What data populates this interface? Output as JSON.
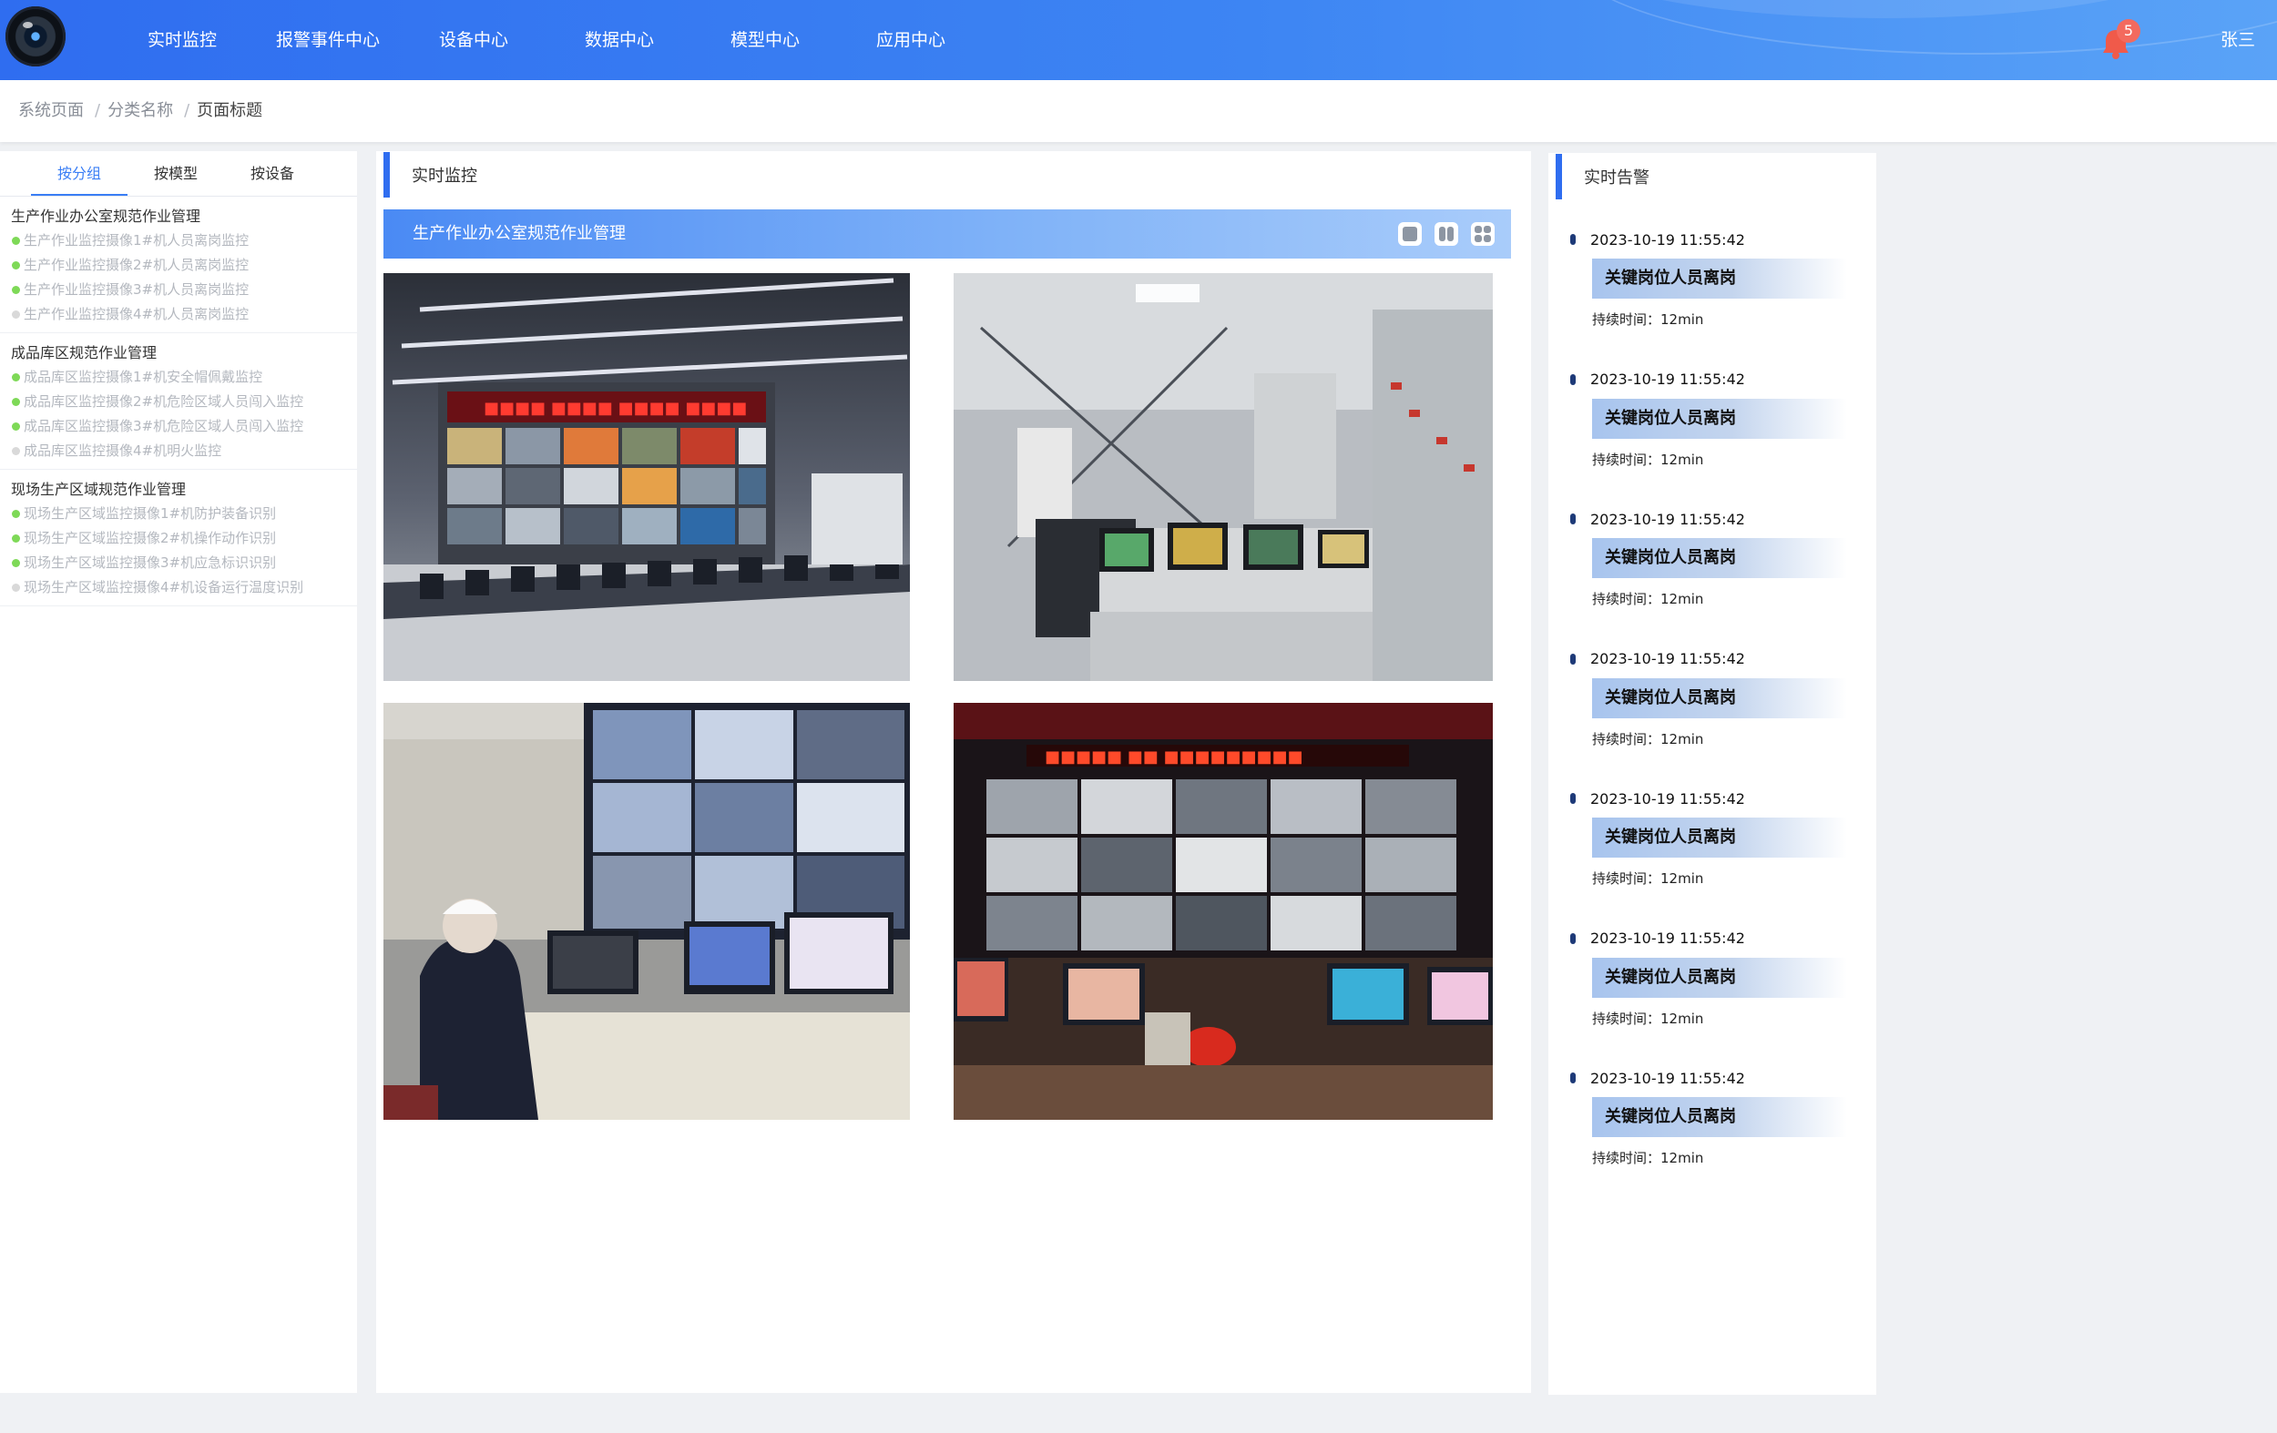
{
  "header": {
    "nav": [
      "实时监控",
      "报警事件中心",
      "设备中心",
      "数据中心",
      "模型中心",
      "应用中心"
    ],
    "notification_count": "5",
    "user_name": "张三",
    "colors": {
      "primary": "#2f6df0",
      "badge": "#f36a5e",
      "bell": "#f05a4a"
    }
  },
  "breadcrumb": {
    "items": [
      "系统页面",
      "分类名称"
    ],
    "current": "页面标题",
    "separator": "/"
  },
  "left_panel": {
    "tabs": [
      "按分组",
      "按模型",
      "按设备"
    ],
    "active_tab": "按分组",
    "groups": [
      {
        "title": "生产作业办公室规范作业管理",
        "cameras": [
          {
            "name": "生产作业监控摄像1#机人员离岗监控",
            "status": "online"
          },
          {
            "name": "生产作业监控摄像2#机人员离岗监控",
            "status": "online"
          },
          {
            "name": "生产作业监控摄像3#机人员离岗监控",
            "status": "online"
          },
          {
            "name": "生产作业监控摄像4#机人员离岗监控",
            "status": "offline"
          }
        ]
      },
      {
        "title": "成品库区规范作业管理",
        "cameras": [
          {
            "name": "成品库区监控摄像1#机安全帽佩戴监控",
            "status": "online"
          },
          {
            "name": "成品库区监控摄像2#机危险区域人员闯入监控",
            "status": "online"
          },
          {
            "name": "成品库区监控摄像3#机危险区域人员闯入监控",
            "status": "online"
          },
          {
            "name": "成品库区监控摄像4#机明火监控",
            "status": "offline"
          }
        ]
      },
      {
        "title": "现场生产区域规范作业管理",
        "cameras": [
          {
            "name": "现场生产区域监控摄像1#机防护装备识别",
            "status": "online"
          },
          {
            "name": "现场生产区域监控摄像2#机操作动作识别",
            "status": "online"
          },
          {
            "name": "现场生产区域监控摄像3#机应急标识识别",
            "status": "online"
          },
          {
            "name": "现场生产区域监控摄像4#机设备运行温度识别",
            "status": "offline"
          }
        ]
      }
    ],
    "status_colors": {
      "online": "#7ed957",
      "offline": "#d9d9d9"
    }
  },
  "center": {
    "title": "实时监控",
    "group_bar_title": "生产作业办公室规范作业管理",
    "layout_options": [
      "single-layout-icon",
      "two-column-layout-icon",
      "four-grid-layout-icon"
    ],
    "feeds": [
      {
        "name": "control-room-video-wall"
      },
      {
        "name": "electrical-control-room"
      },
      {
        "name": "operator-monitoring-station"
      },
      {
        "name": "cctv-video-wall"
      }
    ]
  },
  "right": {
    "title": "实时告警",
    "duration_label": "持续时间：",
    "alerts": [
      {
        "time": "2023-10-19 11:55:42",
        "type": "关键岗位人员离岗",
        "duration": "12min"
      },
      {
        "time": "2023-10-19 11:55:42",
        "type": "关键岗位人员离岗",
        "duration": "12min"
      },
      {
        "time": "2023-10-19 11:55:42",
        "type": "关键岗位人员离岗",
        "duration": "12min"
      },
      {
        "time": "2023-10-19 11:55:42",
        "type": "关键岗位人员离岗",
        "duration": "12min"
      },
      {
        "time": "2023-10-19 11:55:42",
        "type": "关键岗位人员离岗",
        "duration": "12min"
      },
      {
        "time": "2023-10-19 11:55:42",
        "type": "关键岗位人员离岗",
        "duration": "12min"
      },
      {
        "time": "2023-10-19 11:55:42",
        "type": "关键岗位人员离岗",
        "duration": "12min"
      }
    ]
  }
}
